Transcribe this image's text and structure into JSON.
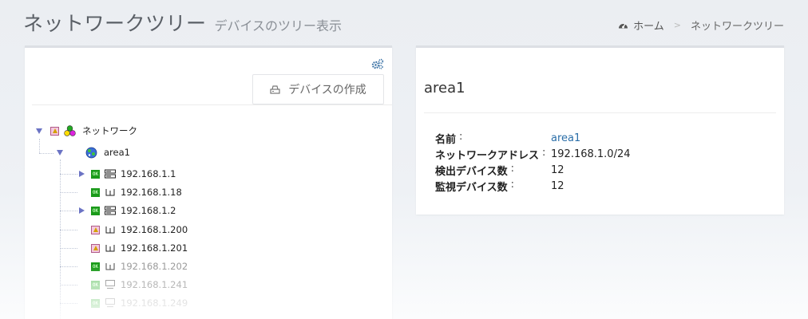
{
  "header": {
    "title": "ネットワークツリー",
    "subtitle": "デバイスのツリー表示"
  },
  "breadcrumb": {
    "home_label": "ホーム",
    "separator": ">",
    "current_label": "ネットワークツリー"
  },
  "tree_panel": {
    "create_button_label": "デバイスの作成",
    "root": {
      "label": "ネットワーク"
    },
    "area": {
      "label": "area1"
    },
    "devices": [
      {
        "label": "192.168.1.1",
        "status": "ok",
        "type": "switch",
        "expandable": true,
        "dim": false
      },
      {
        "label": "192.168.1.18",
        "status": "ok",
        "type": "host",
        "expandable": false,
        "dim": false
      },
      {
        "label": "192.168.1.2",
        "status": "ok",
        "type": "switch",
        "expandable": true,
        "dim": false
      },
      {
        "label": "192.168.1.200",
        "status": "warn",
        "type": "host",
        "expandable": false,
        "dim": false
      },
      {
        "label": "192.168.1.201",
        "status": "warn",
        "type": "host",
        "expandable": false,
        "dim": false
      },
      {
        "label": "192.168.1.202",
        "status": "ok",
        "type": "host",
        "expandable": false,
        "dim": true
      },
      {
        "label": "192.168.1.241",
        "status": "ok",
        "type": "pc",
        "expandable": false,
        "dim": true
      },
      {
        "label": "192.168.1.249",
        "status": "ok",
        "type": "pc",
        "expandable": false,
        "dim": true
      }
    ]
  },
  "detail_panel": {
    "title": "area1",
    "rows": [
      {
        "key": "名前",
        "value": "area1",
        "link": true
      },
      {
        "key": "ネットワークアドレス",
        "value": "192.168.1.0/24",
        "link": false
      },
      {
        "key": "検出デバイス数",
        "value": "12",
        "link": false
      },
      {
        "key": "監視デバイス数",
        "value": "12",
        "link": false
      }
    ],
    "colon": ":"
  },
  "colors": {
    "toggle": "#6b73c4",
    "ok_badge": "#1a9a1a",
    "link": "#2a6ea8"
  }
}
